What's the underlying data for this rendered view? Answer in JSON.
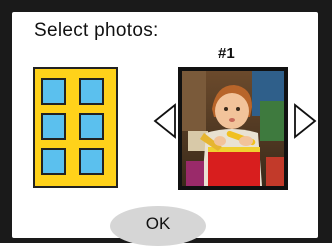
{
  "screen": {
    "title": "Select photos:",
    "photo_number": "#1",
    "ok_label": "OK"
  },
  "layout_preview": {
    "slots_total": 6,
    "columns": 2,
    "rows": 3
  },
  "icons": {
    "previous": "triangle-left-icon",
    "next": "triangle-right-icon"
  },
  "colors": {
    "frame": "#1a1a1a",
    "layout_fill": "#ffd21a",
    "slot_fill": "#5bc0ee",
    "ok_button": "#d6d6d6"
  }
}
